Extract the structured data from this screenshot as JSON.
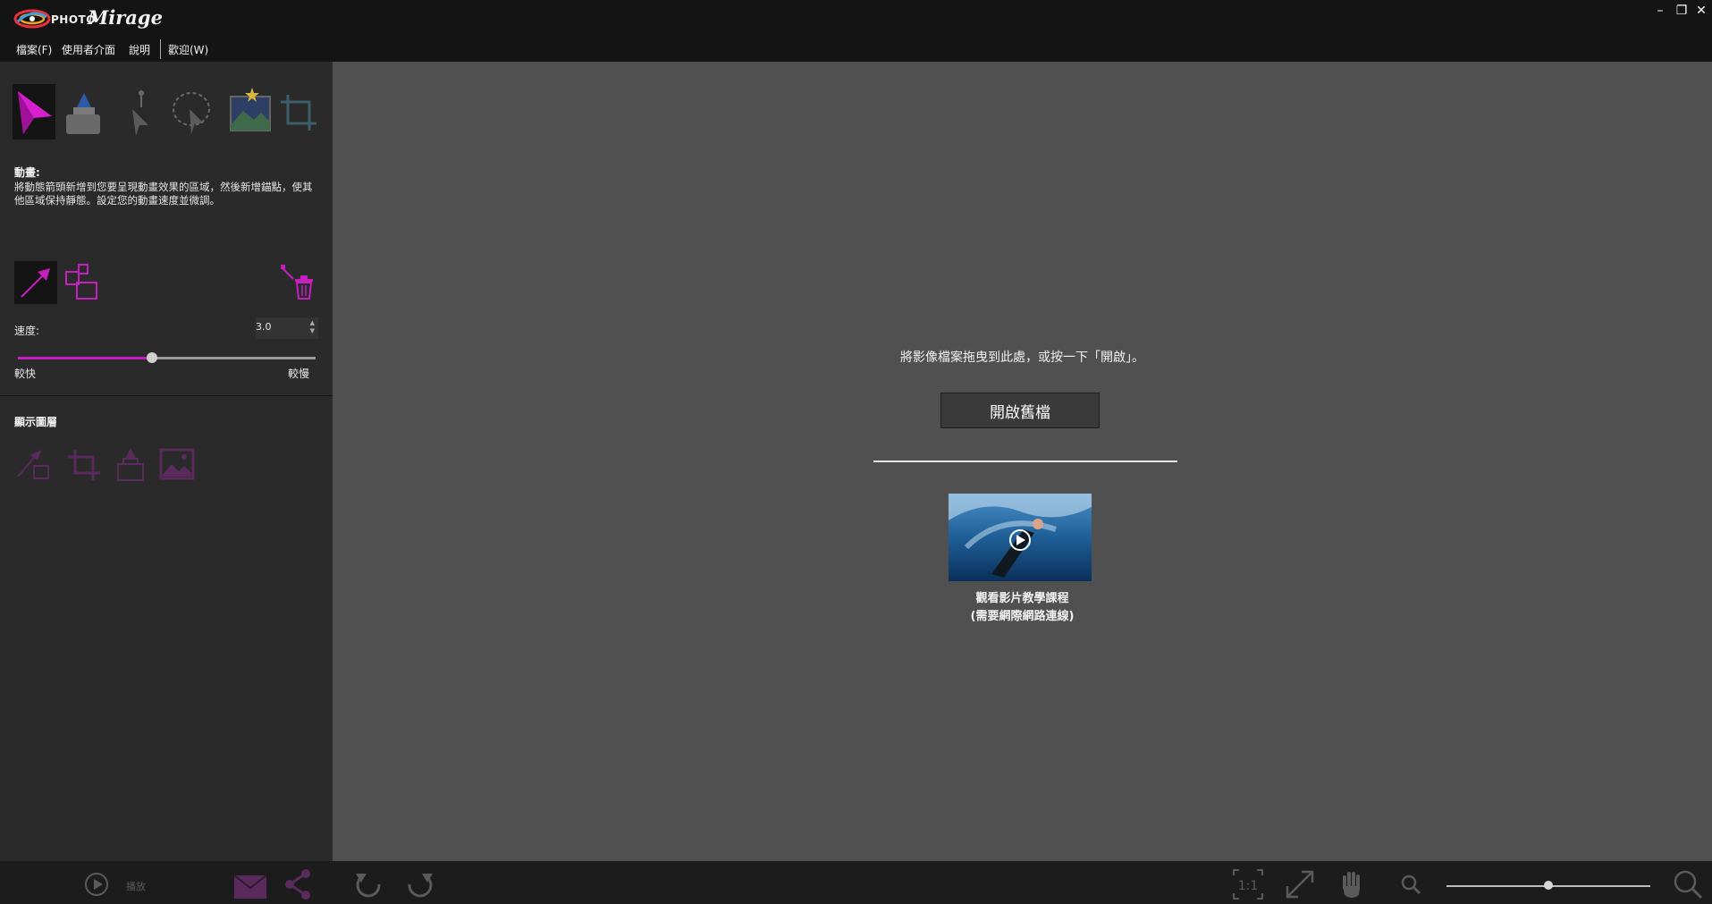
{
  "app": {
    "logo_prefix": "PHOTO",
    "logo_name": "Mirage",
    "window_controls": [
      "–",
      "❐",
      "✕"
    ]
  },
  "menu": [
    {
      "label": "檔案(F)"
    },
    {
      "label": "使用者介面"
    },
    {
      "label": "說明"
    },
    {
      "label": "歡迎(W)"
    }
  ],
  "tools": [
    {
      "name": "animate-tool",
      "icon": "animate-arrow-icon",
      "active": true
    },
    {
      "name": "mask-tool",
      "icon": "mask-brush-icon",
      "active": false
    },
    {
      "name": "anchor-tool",
      "icon": "anchor-point-icon",
      "active": false
    },
    {
      "name": "selection-tool",
      "icon": "lasso-selection-icon",
      "active": false
    },
    {
      "name": "sky-tool",
      "icon": "sky-image-icon",
      "active": false
    },
    {
      "name": "crop-tool",
      "icon": "crop-icon",
      "active": false
    }
  ],
  "animate_section": {
    "title": "動畫:",
    "description": "將動態箭頭新增到您要呈現動畫效果的區域，然後新增錨點，使其他區域保持靜態。設定您的動畫速度並微調。"
  },
  "speed": {
    "label": "速度:",
    "value": "3.0",
    "slider_fraction": 0.45,
    "min_label": "較快",
    "max_label": "較慢"
  },
  "layers": {
    "title": "顯示圖層"
  },
  "canvas": {
    "drop_hint": "將影像檔案拖曳到此處，或按一下「開啟」。",
    "open_button": "開啟舊檔",
    "video_line1": "觀看影片教學課程",
    "video_line2": "(需要網際網路連線)"
  },
  "bottom": {
    "play_label": "播放",
    "zoom_fraction": 0.5
  },
  "colors": {
    "accent": "#c51fbf",
    "panel": "#2a2a2a",
    "canvas": "#505050",
    "chrome": "#141414"
  }
}
